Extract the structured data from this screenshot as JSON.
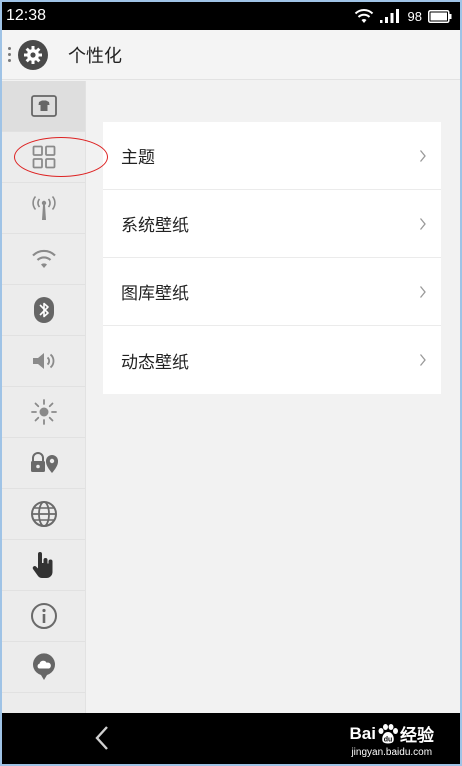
{
  "status_bar": {
    "time": "12:38",
    "battery": "98"
  },
  "header": {
    "title": "个性化"
  },
  "sidebar": {
    "items": [
      {
        "icon": "tshirt-icon",
        "active": false
      },
      {
        "icon": "grid-icon",
        "active": true
      },
      {
        "icon": "antenna-icon",
        "active": false
      },
      {
        "icon": "wifi-icon",
        "active": false
      },
      {
        "icon": "bluetooth-icon",
        "active": false
      },
      {
        "icon": "speaker-icon",
        "active": false
      },
      {
        "icon": "brightness-icon",
        "active": false
      },
      {
        "icon": "lock-location-icon",
        "active": false
      },
      {
        "icon": "globe-icon",
        "active": false
      },
      {
        "icon": "hand-icon",
        "active": false
      },
      {
        "icon": "info-icon",
        "active": false
      },
      {
        "icon": "cloud-icon",
        "active": false
      }
    ]
  },
  "menu": {
    "items": [
      {
        "label": "主题"
      },
      {
        "label": "系统壁纸"
      },
      {
        "label": "图库壁纸"
      },
      {
        "label": "动态壁纸"
      }
    ]
  },
  "watermark": {
    "brand": "Bai",
    "brand2": "du",
    "suffix": "经验",
    "url": "jingyan.baidu.com"
  },
  "colors": {
    "annotation": "#d22222",
    "status_bg": "#000000",
    "page_bg": "#f2f2f2"
  }
}
